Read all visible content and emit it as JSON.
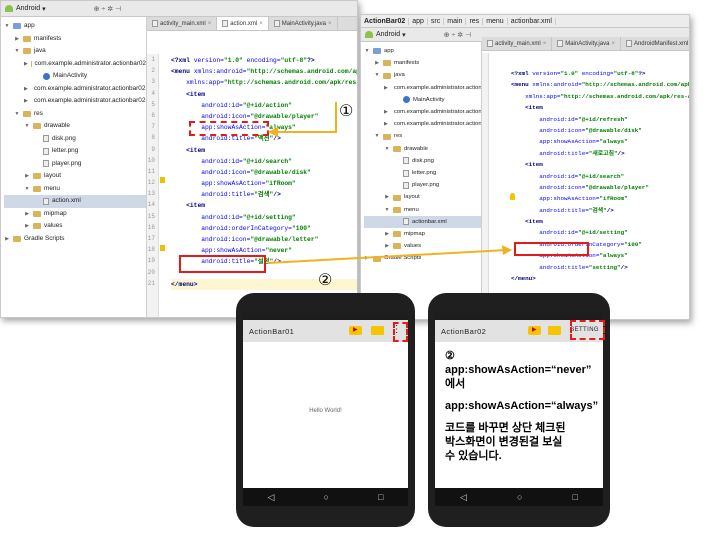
{
  "left_ide": {
    "toolbar_dropdown": "Android",
    "tabs": [
      "activity_main.xml",
      "action.xml",
      "MainActivity.java"
    ],
    "tree": [
      "app",
      "manifests",
      "java",
      "com.example.administrator.actionbar02",
      "MainActivity",
      "com.example.administrator.actionbar02 (androidTest)",
      "com.example.administrator.actionbar02 (test)",
      "res",
      "drawable",
      "disk.png",
      "letter.png",
      "player.png",
      "layout",
      "menu",
      "action.xml",
      "mipmap",
      "values",
      "Gradle Scripts"
    ],
    "gutter": [
      "1",
      "2",
      "3",
      "4",
      "5",
      "6",
      "7",
      "8",
      "9",
      "10",
      "11",
      "12",
      "13",
      "14",
      "15",
      "16",
      "17",
      "18",
      "19",
      "20",
      "21"
    ],
    "code": [
      [
        "<?xml version=\"1.0\" encoding=\"utf-8\"?>"
      ],
      [
        "<menu xmlns:android=\"http://schemas.android.com/apk/res/android\""
      ],
      [
        "    xmlns:app=\"http://schemas.android.com/apk/res-auto\">"
      ],
      [
        "    <item"
      ],
      [
        "        android:id=\"@+id/action\""
      ],
      [
        "        android:icon=\"@drawable/player\""
      ],
      [
        "        app:showAsAction=\"always\""
      ],
      [
        "        android:title=\"액션\"/>"
      ],
      [
        "    <item"
      ],
      [
        "        android:id=\"@+id/search\""
      ],
      [
        "        android:icon=\"@drawable/disk\""
      ],
      [
        "        app:showAsAction=\"ifRoom\""
      ],
      [
        "        android:title=\"검색\"/>"
      ],
      [
        "    <item"
      ],
      [
        "        android:id=\"@+id/setting\""
      ],
      [
        "        android:orderInCategory=\"100\""
      ],
      [
        "        android:icon=\"@drawable/letter\""
      ],
      [
        "        app:showAsAction=\"never\""
      ],
      [
        "        android:title=\"설정\"/>"
      ],
      [
        ""
      ],
      [
        "</menu>"
      ]
    ]
  },
  "right_ide": {
    "breadcrumbs": [
      "ActionBar02",
      "app",
      "src",
      "main",
      "res",
      "menu",
      "actionbar.xml"
    ],
    "toolbar_dropdown": "Android",
    "tabs": [
      "activity_main.xml",
      "MainActivity.java",
      "AndroidManifest.xml",
      "actionbar.xml"
    ],
    "tree": [
      "app",
      "manifests",
      "java",
      "com.example.administrator.actionbar02",
      "MainActivity",
      "com.example.administrator.actionbar02 (android",
      "com.example.administrator.actionbar02 (test)",
      "res",
      "drawable",
      "disk.png",
      "letter.png",
      "player.png",
      "layout",
      "menu",
      "actionbar.xml",
      "mipmap",
      "values",
      "Gradle Scripts"
    ],
    "code": [
      "<?xml version=\"1.0\" encoding=\"utf-8\"?>",
      "<menu xmlns:android=\"http://schemas.android.com/apk/res/android\"",
      "    xmlns:app=\"http://schemas.android.com/apk/res-auto\">",
      "    <item",
      "        android:id=\"@+id/refresh\"",
      "        android:icon=\"@drawable/disk\"",
      "        app:showAsAction=\"always\"",
      "        android:title=\"새로고침\"/>",
      "    <item",
      "        android:id=\"@+id/search\"",
      "        android:icon=\"@drawable/player\"",
      "        app:showAsAction=\"ifRoom\"",
      "        android:title=\"검색\"/>",
      "    <item",
      "        android:id=\"@+id/setting\"",
      "        android:orderInCategory=\"100\"",
      "        app:showAsAction=\"always\"",
      "        android:title=\"setting\"/>",
      "</menu>"
    ]
  },
  "markers": {
    "one": "①",
    "two": "②"
  },
  "phone1": {
    "title": "ActionBar01",
    "body": "Hello World!",
    "overflow": "⋮"
  },
  "phone2": {
    "title": "ActionBar02",
    "setting": "SETTING",
    "note": [
      "②",
      "app:showAsAction=“never”",
      "에서",
      "",
      "app:showAsAction=“always”",
      "",
      "코드를 바꾸면 상단 체크된",
      "박스화면이 변경된걸 보실",
      "수 있습니다."
    ]
  },
  "colors": {
    "highlight": "#e31b1b",
    "arrow": "#f2b21f"
  }
}
